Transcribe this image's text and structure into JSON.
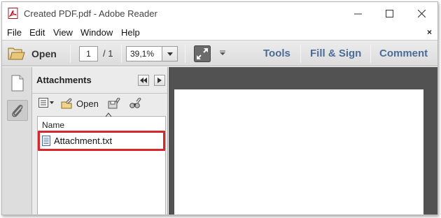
{
  "window": {
    "title": "Created PDF.pdf - Adobe Reader"
  },
  "menubar": {
    "items": [
      "File",
      "Edit",
      "View",
      "Window",
      "Help"
    ],
    "close_glyph": "×"
  },
  "toolbar": {
    "open_label": "Open",
    "page_current": "1",
    "page_total": "/ 1",
    "zoom_value": "39,1%",
    "tabs": [
      "Tools",
      "Fill & Sign",
      "Comment"
    ]
  },
  "attachments_panel": {
    "title": "Attachments",
    "open_label": "Open",
    "column_header": "Name",
    "files": [
      "Attachment.txt"
    ]
  },
  "colors": {
    "highlight": "#d9262b",
    "tab_text": "#4a6c99",
    "document_background": "#525252"
  },
  "icons": [
    "pdf-app-icon",
    "minimize-icon",
    "maximize-icon",
    "close-icon",
    "folder-open-icon",
    "chevron-down-icon",
    "fullscreen-icon",
    "pages-icon",
    "paperclip-icon",
    "double-left-arrow-icon",
    "right-arrow-icon",
    "options-icon",
    "attachment-open-icon",
    "save-attachment-icon",
    "search-attachment-icon",
    "text-file-icon"
  ]
}
